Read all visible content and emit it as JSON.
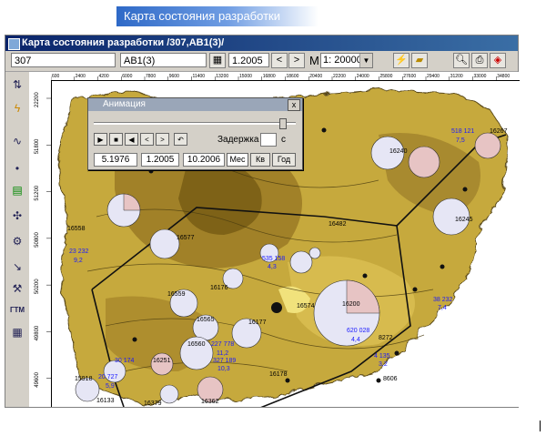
{
  "banner": {
    "title": "Карта состояния разработки"
  },
  "window": {
    "title": "Карта состояния разработки /307,АВ1(3)/"
  },
  "toolbar": {
    "field1": "307",
    "field2": "АВ1(3)",
    "date": "1.2005",
    "prev": "<",
    "next": ">",
    "m_label": "M",
    "scale": "1: 20000"
  },
  "ruler": {
    "top_ticks": [
      "600",
      "2400",
      "4200",
      "6000",
      "7800",
      "9600",
      "11400",
      "13200",
      "15000",
      "16800",
      "18600",
      "20400",
      "22200",
      "24000",
      "25800",
      "27600",
      "29400",
      "31200",
      "33000",
      "34800"
    ],
    "left_ticks": [
      "22200",
      "51800",
      "51200",
      "50800",
      "50200",
      "49800",
      "49600"
    ]
  },
  "animation": {
    "title": "Анимация",
    "close": "x",
    "buttons": [
      "▶",
      "■",
      "◀",
      "<",
      ">",
      "↶"
    ],
    "delay_label": "Задержка",
    "delay_value": "",
    "delay_unit": "с",
    "start": "5.1976",
    "current": "1.2005",
    "end": "10.2006",
    "period_month": "Мес",
    "period_quarter": "Кв",
    "period_year": "Год"
  },
  "wells": [
    {
      "id": "16577",
      "label": "16577"
    },
    {
      "id": "16558",
      "label": "16558"
    },
    {
      "id": "16176",
      "label": "16176"
    },
    {
      "id": "16559",
      "label": "16559"
    },
    {
      "id": "16565",
      "label": "16565"
    },
    {
      "id": "16177",
      "label": "16177"
    },
    {
      "id": "16200",
      "label": "16200"
    },
    {
      "id": "16245",
      "label": "16245"
    },
    {
      "id": "16267",
      "label": "16267"
    },
    {
      "id": "16240",
      "label": "16240"
    },
    {
      "id": "16482",
      "label": "16482"
    },
    {
      "id": "16560",
      "label": "16560"
    },
    {
      "id": "16251",
      "label": "16251"
    },
    {
      "id": "16379",
      "label": "16379"
    },
    {
      "id": "16362",
      "label": "16362"
    },
    {
      "id": "16133",
      "label": "16133"
    },
    {
      "id": "16178",
      "label": "16178"
    },
    {
      "id": "15918",
      "label": "15918"
    },
    {
      "id": "16574",
      "label": "16574"
    },
    {
      "id": "8272",
      "label": "8272"
    },
    {
      "id": "8606",
      "label": "8606"
    }
  ],
  "values": [
    "518 121",
    "7,5",
    "620 028",
    "4,4",
    "4 135",
    "3,2",
    "227 778",
    "11,2",
    "535 158",
    "4,3",
    "327 189",
    "10,3",
    "30 174",
    "20 727",
    "5,9",
    "23 232",
    "9,2",
    "38 232",
    "7,4"
  ],
  "colors": {
    "accent": "#0a246a",
    "map_dark": "#8c6d1f",
    "map_light": "#e8d27a",
    "pie_light": "#e6e6f5",
    "pie_pink": "#e7c4c4",
    "label_blue": "#1a1aff"
  }
}
